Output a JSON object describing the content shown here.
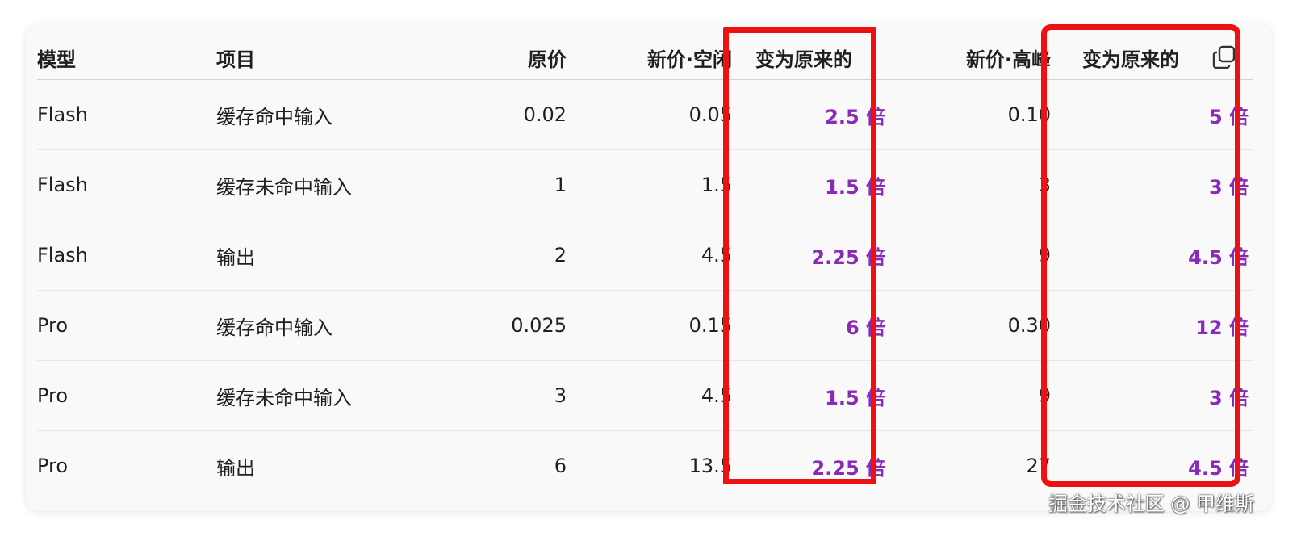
{
  "table": {
    "headers": {
      "model": "模型",
      "item": "项目",
      "original": "原价",
      "new_idle": "新价·空闲",
      "ratio_idle": "变为原来的",
      "new_peak": "新价·高峰",
      "ratio_peak": "变为原来的"
    },
    "rows": [
      {
        "model": "Flash",
        "item": "缓存命中输入",
        "original": "0.02",
        "new_idle": "0.05",
        "ratio_idle": "2.5 倍",
        "new_peak": "0.10",
        "ratio_peak": "5 倍"
      },
      {
        "model": "Flash",
        "item": "缓存未命中输入",
        "original": "1",
        "new_idle": "1.5",
        "ratio_idle": "1.5 倍",
        "new_peak": "3",
        "ratio_peak": "3 倍"
      },
      {
        "model": "Flash",
        "item": "输出",
        "original": "2",
        "new_idle": "4.5",
        "ratio_idle": "2.25 倍",
        "new_peak": "9",
        "ratio_peak": "4.5 倍"
      },
      {
        "model": "Pro",
        "item": "缓存命中输入",
        "original": "0.025",
        "new_idle": "0.15",
        "ratio_idle": "6 倍",
        "new_peak": "0.30",
        "ratio_peak": "12 倍"
      },
      {
        "model": "Pro",
        "item": "缓存未命中输入",
        "original": "3",
        "new_idle": "4.5",
        "ratio_idle": "1.5 倍",
        "new_peak": "9",
        "ratio_peak": "3 倍"
      },
      {
        "model": "Pro",
        "item": "输出",
        "original": "6",
        "new_idle": "13.5",
        "ratio_idle": "2.25 倍",
        "new_peak": "27",
        "ratio_peak": "4.5 倍"
      }
    ]
  },
  "icons": {
    "copy": "copy-icon"
  },
  "colors": {
    "ratio_text": "#8a2bb8",
    "highlight_box": "#ee1111"
  },
  "watermark": "掘金技术社区 @ 甲维斯"
}
